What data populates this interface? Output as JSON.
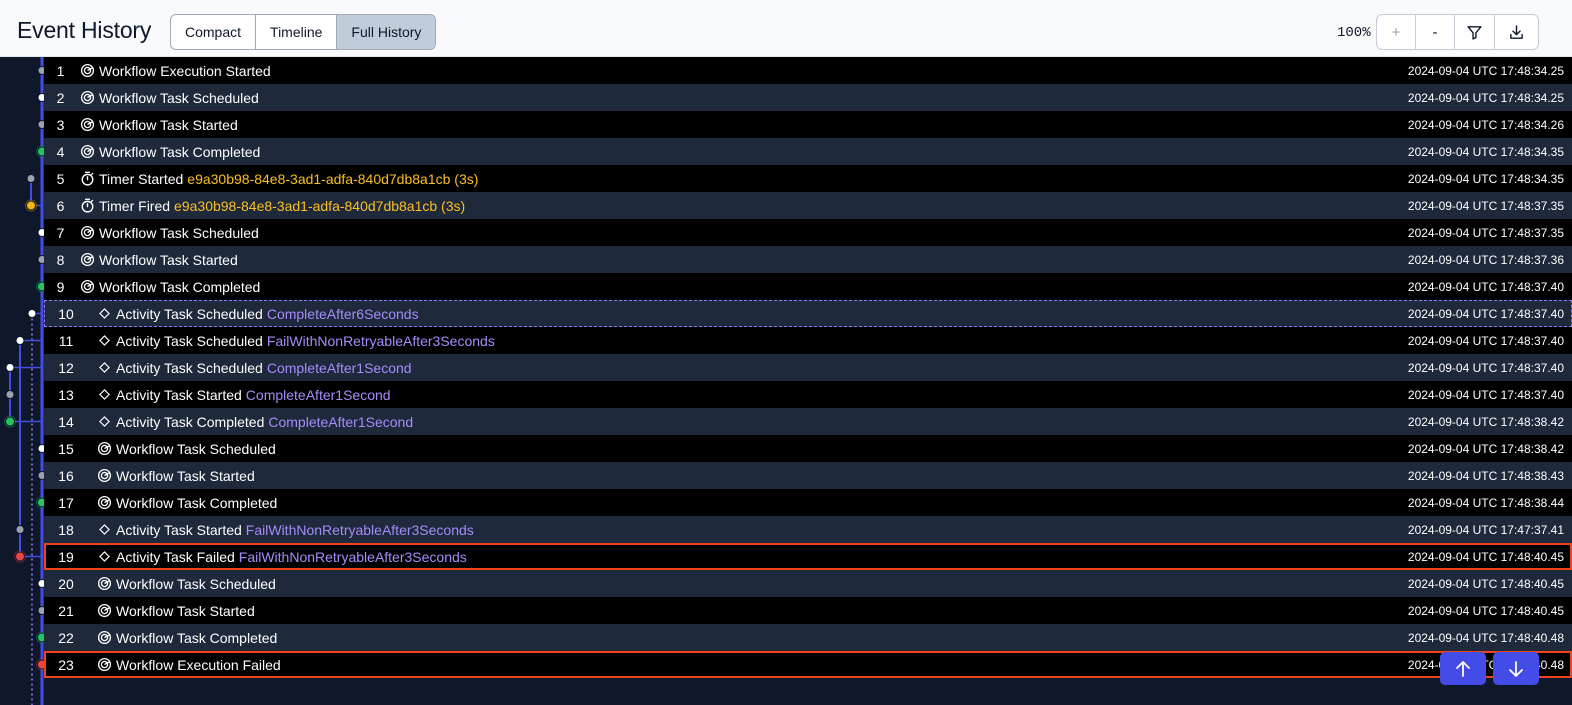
{
  "header": {
    "title": "Event History",
    "views": [
      "Compact",
      "Timeline",
      "Full History"
    ],
    "active_view": "Full History",
    "zoom_level": "100%",
    "zoom_in_label": "+",
    "zoom_out_label": "-"
  },
  "colors": {
    "completed": "#22c55e",
    "failed": "#ef4444",
    "timer": "#f5b60c",
    "scheduled": "#ffffff",
    "started": "#9ca3af",
    "lane": "#444ce7"
  },
  "events": [
    {
      "id": "1",
      "name": "Workflow Execution Started",
      "detail": "",
      "time": "2024-09-04 UTC 17:48:34.25",
      "icon": "workflow-icon",
      "kind": "workflow"
    },
    {
      "id": "2",
      "name": "Workflow Task Scheduled",
      "detail": "",
      "time": "2024-09-04 UTC 17:48:34.25",
      "icon": "workflow-icon",
      "kind": "workflow"
    },
    {
      "id": "3",
      "name": "Workflow Task Started",
      "detail": "",
      "time": "2024-09-04 UTC 17:48:34.26",
      "icon": "workflow-icon",
      "kind": "workflow"
    },
    {
      "id": "4",
      "name": "Workflow Task Completed",
      "detail": "",
      "time": "2024-09-04 UTC 17:48:34.35",
      "icon": "workflow-icon",
      "kind": "workflow"
    },
    {
      "id": "5",
      "name": "Timer Started",
      "detail": "e9a30b98-84e8-3ad1-adfa-840d7db8a1cb (3s)",
      "time": "2024-09-04 UTC 17:48:34.35",
      "icon": "timer-icon",
      "kind": "timer"
    },
    {
      "id": "6",
      "name": "Timer Fired",
      "detail": "e9a30b98-84e8-3ad1-adfa-840d7db8a1cb (3s)",
      "time": "2024-09-04 UTC 17:48:37.35",
      "icon": "timer-icon",
      "kind": "timer"
    },
    {
      "id": "7",
      "name": "Workflow Task Scheduled",
      "detail": "",
      "time": "2024-09-04 UTC 17:48:37.35",
      "icon": "workflow-icon",
      "kind": "workflow"
    },
    {
      "id": "8",
      "name": "Workflow Task Started",
      "detail": "",
      "time": "2024-09-04 UTC 17:48:37.36",
      "icon": "workflow-icon",
      "kind": "workflow"
    },
    {
      "id": "9",
      "name": "Workflow Task Completed",
      "detail": "",
      "time": "2024-09-04 UTC 17:48:37.40",
      "icon": "workflow-icon",
      "kind": "workflow"
    },
    {
      "id": "10",
      "name": "Activity Task Scheduled",
      "detail": "CompleteAfter6Seconds",
      "time": "2024-09-04 UTC 17:48:37.40",
      "icon": "activity-icon",
      "kind": "activity"
    },
    {
      "id": "11",
      "name": "Activity Task Scheduled",
      "detail": "FailWithNonRetryableAfter3Seconds",
      "time": "2024-09-04 UTC 17:48:37.40",
      "icon": "activity-icon",
      "kind": "activity"
    },
    {
      "id": "12",
      "name": "Activity Task Scheduled",
      "detail": "CompleteAfter1Second",
      "time": "2024-09-04 UTC 17:48:37.40",
      "icon": "activity-icon",
      "kind": "activity"
    },
    {
      "id": "13",
      "name": "Activity Task Started",
      "detail": "CompleteAfter1Second",
      "time": "2024-09-04 UTC 17:48:37.40",
      "icon": "activity-icon",
      "kind": "activity"
    },
    {
      "id": "14",
      "name": "Activity Task Completed",
      "detail": "CompleteAfter1Second",
      "time": "2024-09-04 UTC 17:48:38.42",
      "icon": "activity-icon",
      "kind": "activity"
    },
    {
      "id": "15",
      "name": "Workflow Task Scheduled",
      "detail": "",
      "time": "2024-09-04 UTC 17:48:38.42",
      "icon": "workflow-icon",
      "kind": "workflow"
    },
    {
      "id": "16",
      "name": "Workflow Task Started",
      "detail": "",
      "time": "2024-09-04 UTC 17:48:38.43",
      "icon": "workflow-icon",
      "kind": "workflow"
    },
    {
      "id": "17",
      "name": "Workflow Task Completed",
      "detail": "",
      "time": "2024-09-04 UTC 17:48:38.44",
      "icon": "workflow-icon",
      "kind": "workflow"
    },
    {
      "id": "18",
      "name": "Activity Task Started",
      "detail": "FailWithNonRetryableAfter3Seconds",
      "time": "2024-09-04 UTC 17:47:37.41",
      "icon": "activity-icon",
      "kind": "activity"
    },
    {
      "id": "19",
      "name": "Activity Task Failed",
      "detail": "FailWithNonRetryableAfter3Seconds",
      "time": "2024-09-04 UTC 17:48:40.45",
      "icon": "activity-icon",
      "kind": "activity"
    },
    {
      "id": "20",
      "name": "Workflow Task Scheduled",
      "detail": "",
      "time": "2024-09-04 UTC 17:48:40.45",
      "icon": "workflow-icon",
      "kind": "workflow"
    },
    {
      "id": "21",
      "name": "Workflow Task Started",
      "detail": "",
      "time": "2024-09-04 UTC 17:48:40.45",
      "icon": "workflow-icon",
      "kind": "workflow"
    },
    {
      "id": "22",
      "name": "Workflow Task Completed",
      "detail": "",
      "time": "2024-09-04 UTC 17:48:40.48",
      "icon": "workflow-icon",
      "kind": "workflow"
    },
    {
      "id": "23",
      "name": "Workflow Execution Failed",
      "detail": "",
      "time": "2024-09-04 UTC 17:48:40.48",
      "icon": "workflow-icon",
      "kind": "workflow"
    }
  ],
  "selected_event": "10",
  "failed_events": [
    "19",
    "23"
  ]
}
